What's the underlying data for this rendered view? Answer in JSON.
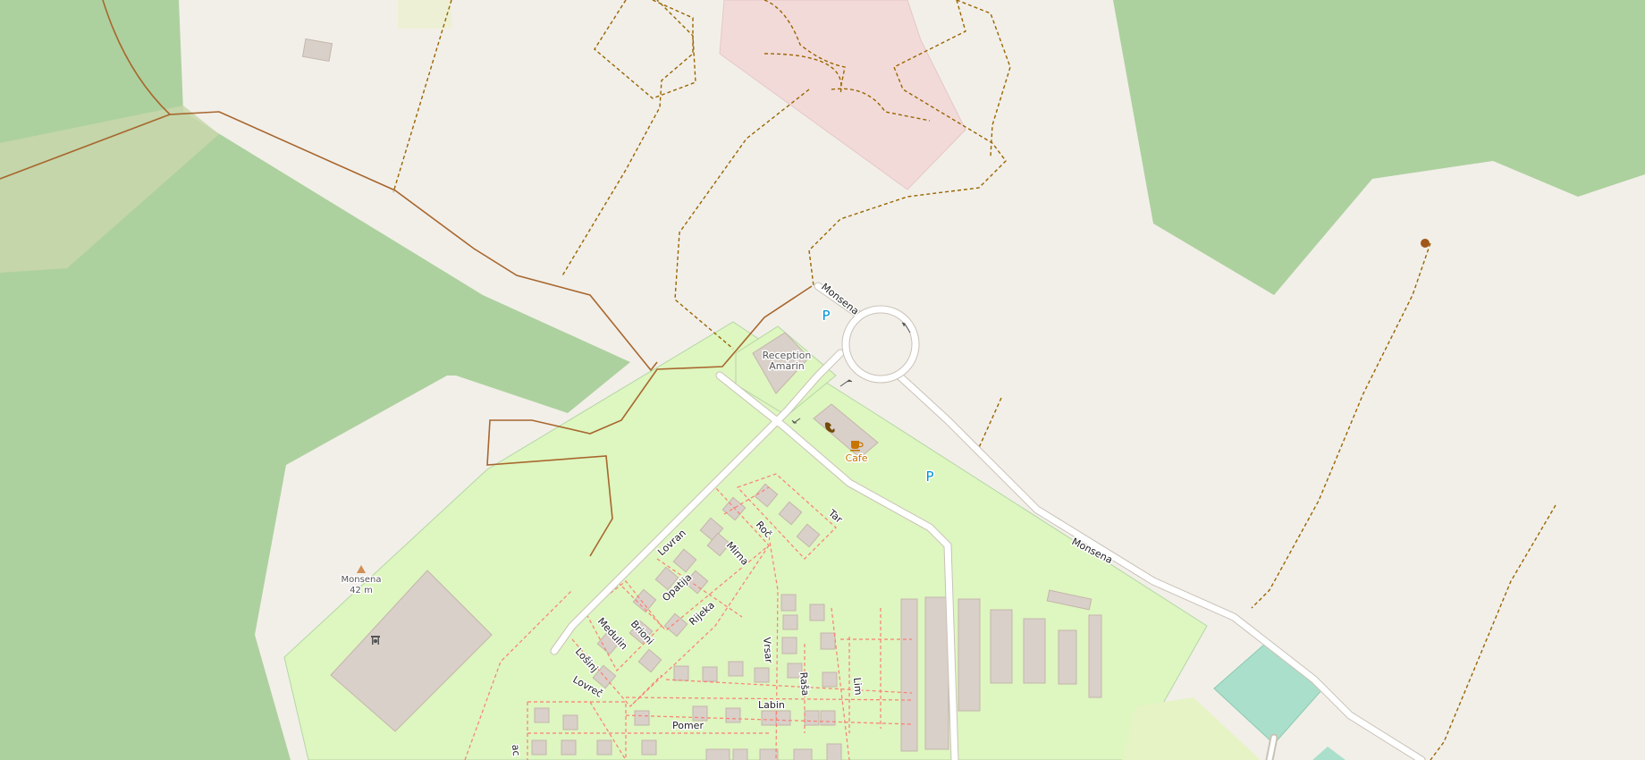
{
  "map": {
    "colors": {
      "land": "#f2efe9",
      "forest": "#add19e",
      "scrub": "#c8d7ab",
      "camp_site": "#def6c0",
      "residential_pink": "#f2dad9",
      "building": "#d9d0c9",
      "road": "#ffffff",
      "path": "#a8672e",
      "track": "#996600",
      "cafe": "#c77400",
      "parking": "#0092da",
      "water_feature": "#aad3df",
      "pitch": "#aae0cb"
    },
    "labels": {
      "reception": "Reception",
      "amarin": "Amarin",
      "cafe": "Cafe",
      "peak_name": "Monsena",
      "peak_elevation": "42 m",
      "parking_symbol": "P",
      "road_monsena_north": "Monsena",
      "road_monsena_east": "Monsena",
      "streets": {
        "tar": "Tar",
        "roc": "Roč",
        "mirna": "Mirna",
        "lovran": "Lovran",
        "opatija": "Opatija",
        "rijeka": "Rijeka",
        "brioni": "Brioni",
        "medulin": "Medulin",
        "losinj": "Lošinj",
        "lovrec": "Lovreč",
        "vrsar": "Vrsar",
        "rasa": "Raša",
        "lim": "Lim",
        "labin": "Labin",
        "pomer": "Pomer",
        "partial": "ac"
      }
    },
    "icons": [
      "peak-icon",
      "playground-icon",
      "cafe-icon",
      "telephone-icon",
      "parking-icon",
      "poi-dot-icon"
    ]
  }
}
